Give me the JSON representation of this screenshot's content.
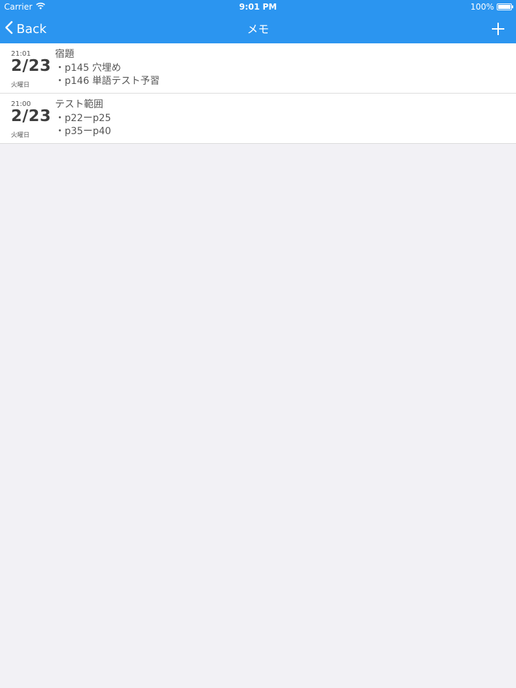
{
  "status_bar": {
    "carrier": "Carrier",
    "time": "9:01 PM",
    "battery": "100%"
  },
  "nav": {
    "back_label": "Back",
    "title": "メモ"
  },
  "memos": [
    {
      "time": "21:01",
      "date": "2/23",
      "weekday": "火曜日",
      "title": "宿題",
      "lines": [
        "・p145 穴埋め",
        "・p146 単語テスト予習"
      ]
    },
    {
      "time": "21:00",
      "date": "2/23",
      "weekday": "火曜日",
      "title": "テスト範囲",
      "lines": [
        "・p22ーp25",
        "・p35ーp40"
      ]
    }
  ],
  "colors": {
    "accent": "#2b95f0",
    "background": "#f2f1f5",
    "row_background": "#ffffff",
    "text": "#555555"
  }
}
